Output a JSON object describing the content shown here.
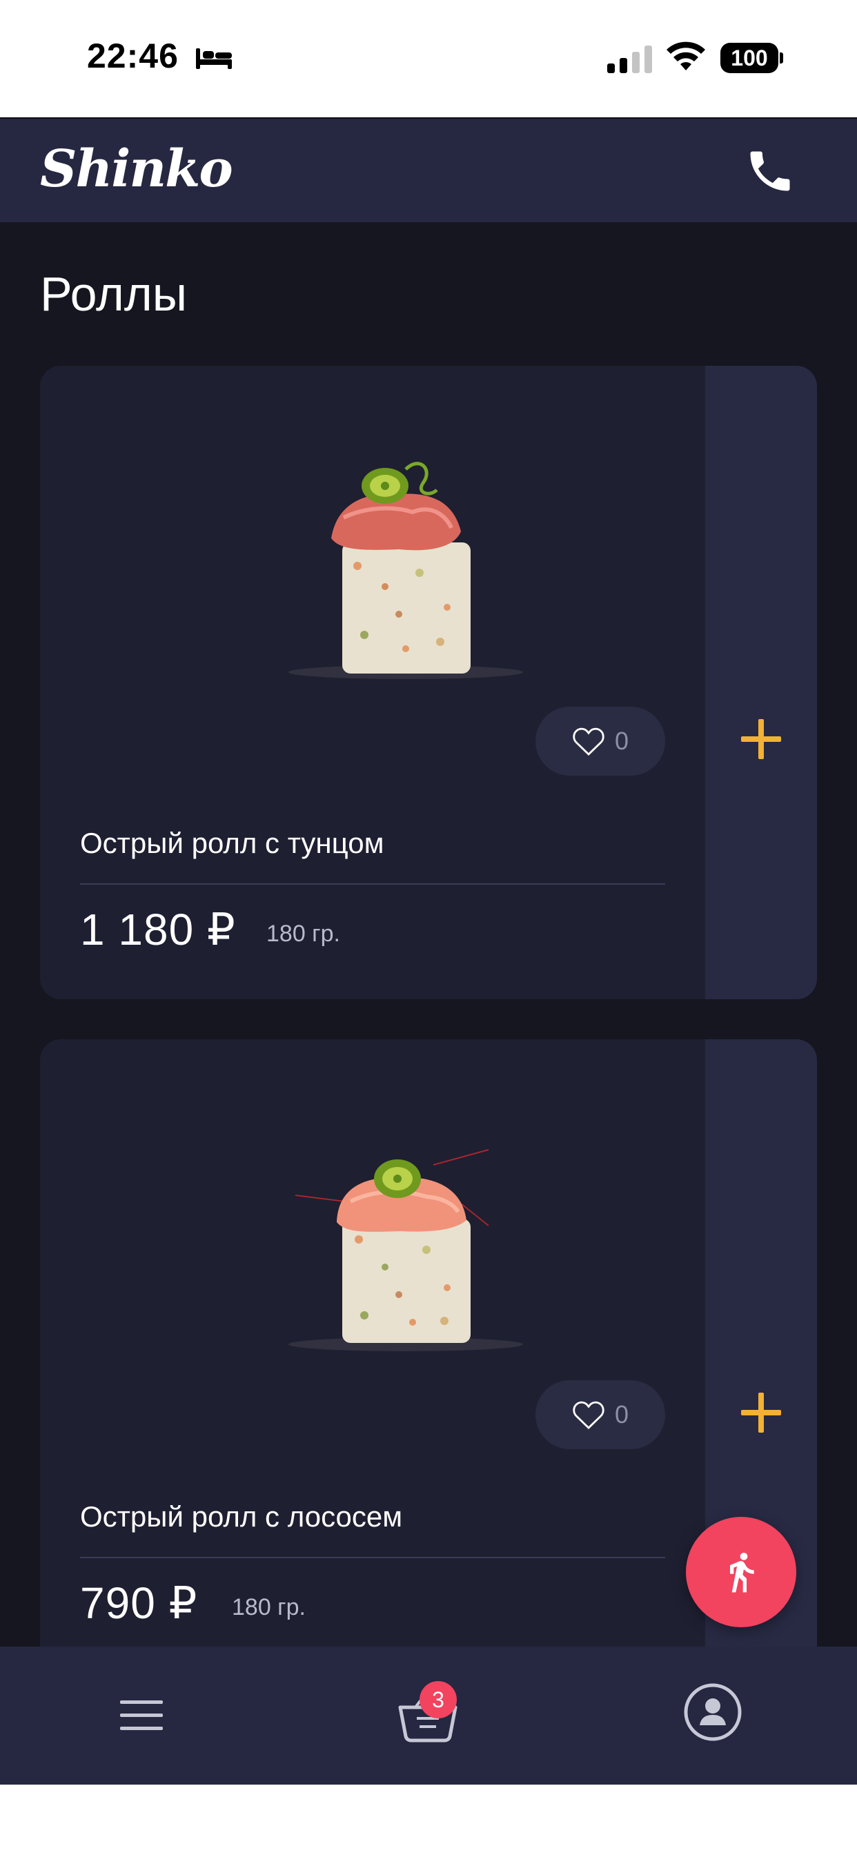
{
  "status_bar": {
    "time": "22:46",
    "battery": "100"
  },
  "header": {
    "logo": "Shinko"
  },
  "page": {
    "title": "Роллы"
  },
  "products": [
    {
      "name": "Острый ролл с тунцом",
      "price": "1 180 ₽",
      "weight": "180 гр.",
      "likes": "0"
    },
    {
      "name": "Острый ролл с лососем",
      "price": "790 ₽",
      "weight": "180 гр.",
      "likes": "0"
    }
  ],
  "cart": {
    "count": "3"
  },
  "colors": {
    "accent": "#f2b233",
    "badge": "#f2435f",
    "background": "#15161f",
    "card": "#1e1f31",
    "nav": "#262741"
  },
  "icons": [
    "bed-icon",
    "signal-icon",
    "wifi-icon",
    "phone-icon",
    "heart-icon",
    "plus-icon",
    "walking-icon",
    "menu-icon",
    "basket-icon",
    "profile-icon"
  ]
}
